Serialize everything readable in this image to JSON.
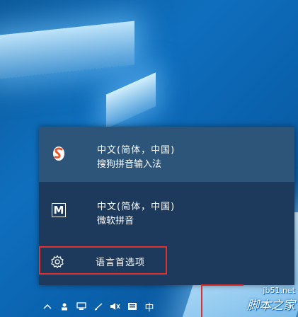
{
  "language_flyout": {
    "items": [
      {
        "name": "中文(简体，中国)",
        "input_method": "搜狗拼音输入法",
        "icon": "sogou-s-icon",
        "selected": true
      },
      {
        "name": "中文(简体，中国)",
        "input_method": "微软拼音",
        "icon": "microsoft-pinyin-m-icon",
        "selected": false
      }
    ],
    "preferences_label": "语言首选项"
  },
  "taskbar": {
    "tray_icons": [
      "chevron-up-icon",
      "user-icon",
      "network-icon",
      "pen-icon",
      "volume-icon",
      "action-center-icon",
      "ime-indicator"
    ],
    "ime_label": "中"
  },
  "watermark": {
    "url": "jb51.net",
    "name": "脚本之家"
  },
  "colors": {
    "flyout_bg": "#1d3a5c",
    "selected_bg": "#2c5579",
    "highlight_red": "#e03030",
    "desktop_blue": "#0f6fbe"
  }
}
